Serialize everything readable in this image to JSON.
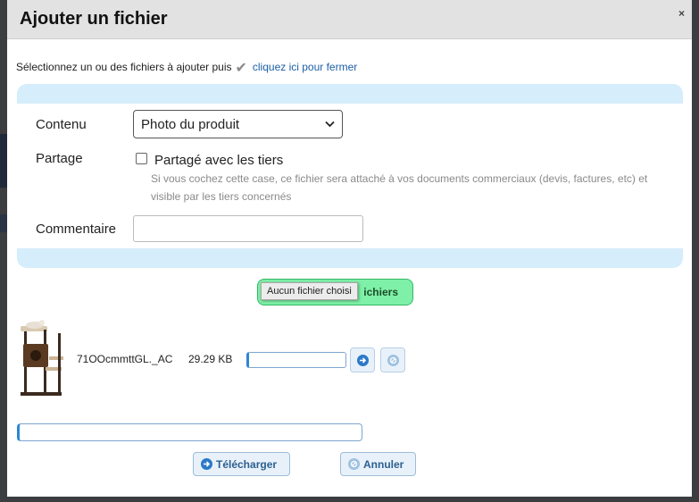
{
  "dialog": {
    "title": "Ajouter un fichier",
    "close_glyph": "×"
  },
  "instruction": {
    "text": "Sélectionnez un ou des fichiers à ajouter puis",
    "check_glyph": "✔",
    "link": "cliquez ici pour fermer"
  },
  "form": {
    "contenu_label": "Contenu",
    "contenu_value": "Photo du produit",
    "partage_label": "Partage",
    "partage_checkbox_label": "Partagé avec les tiers",
    "partage_checked": false,
    "partage_help": "Si vous cochez cette case, ce fichier sera attaché à vos documents commerciaux (devis, factures, etc) et visible par les tiers concernés",
    "commentaire_label": "Commentaire",
    "commentaire_value": ""
  },
  "file_picker": {
    "button_label_visible": "ichiers",
    "tooltip": "Aucun fichier choisi"
  },
  "files": [
    {
      "name": "71OOcmmttGL._AC",
      "size": "29.29 KB"
    }
  ],
  "actions": {
    "upload": "Télécharger",
    "cancel": "Annuler"
  },
  "colors": {
    "header_bg": "#e2e2e2",
    "panel_band": "#d6edfb",
    "picker_green": "#7ff0a7",
    "link_blue": "#1b5fa8",
    "button_text": "#2c5f8f"
  },
  "icons": {
    "confirm": "check-icon",
    "start_upload": "arrow-right-circle-icon",
    "cancel": "ban-icon"
  }
}
